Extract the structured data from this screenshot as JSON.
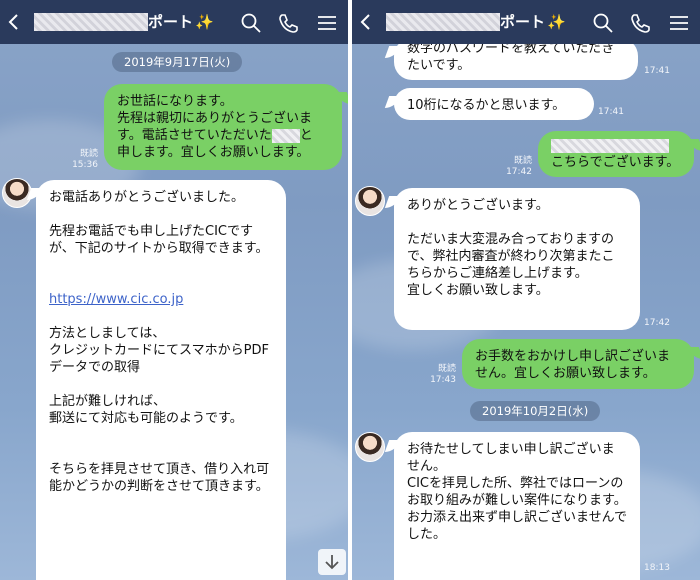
{
  "left": {
    "header": {
      "title_suffix": "ポート",
      "sparkle": "✨"
    },
    "date": "2019年9月17日(火)",
    "messages": [
      {
        "dir": "out",
        "read": "既読",
        "time": "15:36",
        "before": "お世話になります。\n先程は親切にありがとうございます。電話させていただいた",
        "after": "と\n申します。宜しくお願いします。"
      },
      {
        "dir": "in",
        "greeting": "お電話ありがとうございました。\n\n先程お電話でも申し上げたCICですが、下記のサイトから取得できます。\n\n\n",
        "link": "https://www.cic.co.jp",
        "rest": "\n\n方法としましては、\nクレジットカードにてスマホからPDFデータでの取得\n\n上記が難しければ、\n郵送にて対応も可能のようです。\n\n\nそちらを拝見させて頂き、借り入れ可能かどうかの判断をさせて頂きます。"
      }
    ],
    "scroll_icon": "arrow-down-icon"
  },
  "right": {
    "header": {
      "title_suffix": "ポート",
      "sparkle": "✨"
    },
    "messages": [
      {
        "dir": "in",
        "text": "数字のパスワードを教えていただきたいです。",
        "time": "17:41"
      },
      {
        "dir": "in",
        "text": "10桁になるかと思います。",
        "time": "17:41"
      },
      {
        "dir": "out",
        "read": "既読",
        "time": "17:42",
        "text": "こちらでございます。"
      },
      {
        "dir": "in",
        "text": "ありがとうございます。\n\nただいま大変混み合っておりますので、弊社内審査が終わり次第またこちらからご連絡差し上げます。\n宜しくお願い致します。",
        "time": "17:42"
      },
      {
        "dir": "out",
        "read": "既読",
        "time": "17:43",
        "text": "お手数をおかけし申し訳ございません。宜しくお願い致します。"
      }
    ],
    "date": "2019年10月2日(水)",
    "last": {
      "dir": "in",
      "text": "お待たせしてしまい申し訳ございません。\nCICを拝見した所、弊社ではローンのお取り組みが難しい案件になります。\nお力添え出来ず申し訳ございませんでした。",
      "time": "18:13"
    }
  },
  "colors": {
    "header": "#2a3a5c",
    "bubble_out": "#7ad065",
    "bubble_in": "#ffffff",
    "link": "#3d63c9"
  }
}
